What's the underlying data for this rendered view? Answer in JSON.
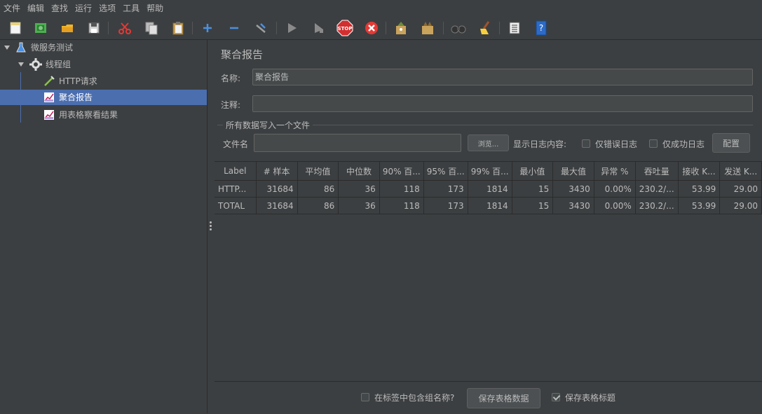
{
  "menu": [
    "文件",
    "编辑",
    "查找",
    "运行",
    "选项",
    "工具",
    "帮助"
  ],
  "toolbar": {
    "icons": [
      "new-icon",
      "templates-icon",
      "open-icon",
      "save-icon",
      "cut-icon",
      "copy-icon",
      "paste-icon",
      "expand-icon",
      "collapse-icon",
      "toggle-icon",
      "start-icon",
      "start-no-pause-icon",
      "stop-icon",
      "shutdown-icon",
      "clear-icon",
      "clear-all-icon",
      "search-icon",
      "reset-search-icon",
      "function-helper-icon",
      "help-icon"
    ],
    "stop_label": "STOP"
  },
  "tree": {
    "items": [
      {
        "label": "微服务测试",
        "icon": "flask-icon"
      },
      {
        "label": "线程组",
        "icon": "gear-icon"
      },
      {
        "label": "HTTP请求",
        "icon": "pipette-icon"
      },
      {
        "label": "聚合报告",
        "icon": "graph-icon"
      },
      {
        "label": "用表格察看结果",
        "icon": "graph-icon"
      }
    ]
  },
  "panel": {
    "title": "聚合报告",
    "name_label": "名称:",
    "name_value": "聚合报告",
    "comment_label": "注释:",
    "comment_value": "",
    "file_group": "所有数据写入一个文件",
    "filename_label": "文件名",
    "filename_value": "",
    "browse_label": "浏览...",
    "log_label": "显示日志内容:",
    "errors_only": "仅错误日志",
    "success_only": "仅成功日志",
    "configure": "配置"
  },
  "table": {
    "headers": [
      "Label",
      "# 样本",
      "平均值",
      "中位数",
      "90% 百...",
      "95% 百...",
      "99% 百...",
      "最小值",
      "最大值",
      "异常 %",
      "吞吐量",
      "接收 K...",
      "发送 K..."
    ],
    "rows": [
      [
        "HTTP...",
        "31684",
        "86",
        "36",
        "118",
        "173",
        "1814",
        "15",
        "3430",
        "0.00%",
        "230.2/...",
        "53.99",
        "29.00"
      ],
      [
        "TOTAL",
        "31684",
        "86",
        "36",
        "118",
        "173",
        "1814",
        "15",
        "3430",
        "0.00%",
        "230.2/...",
        "53.99",
        "29.00"
      ]
    ]
  },
  "footer": {
    "include_group": "在标签中包含组名称?",
    "include_group_checked": false,
    "save_table": "保存表格数据",
    "save_header": "保存表格标题",
    "save_header_checked": true
  }
}
